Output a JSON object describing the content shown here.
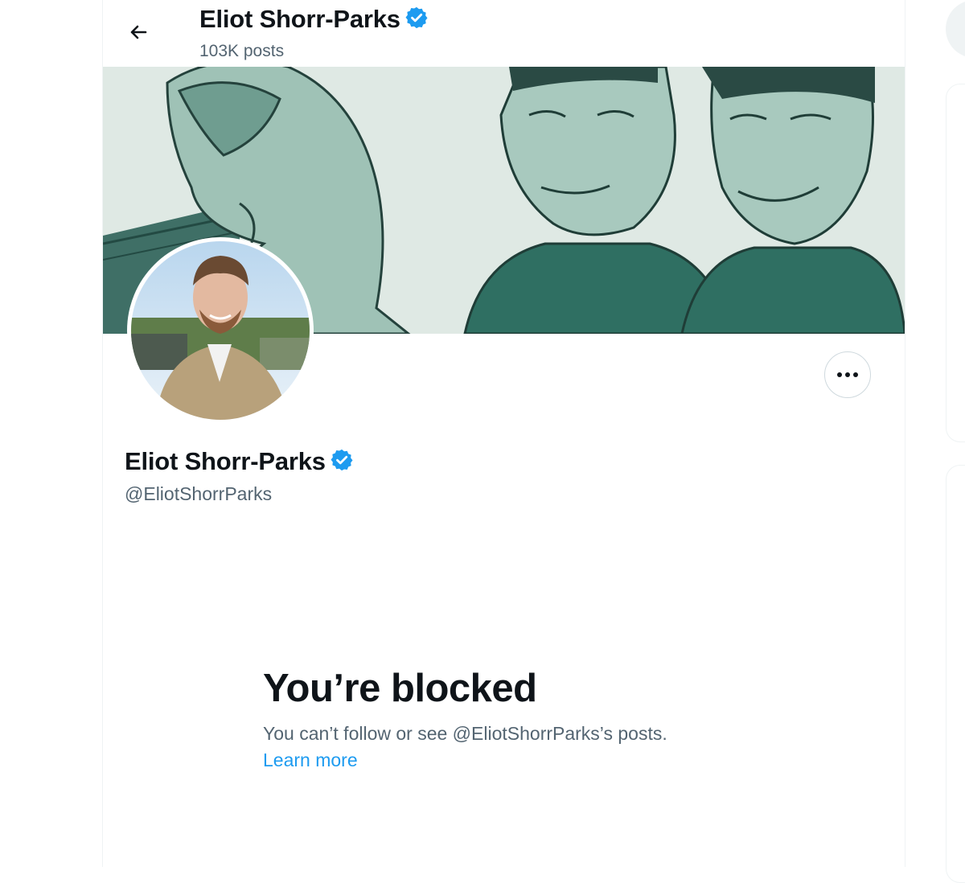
{
  "header": {
    "name": "Eliot Shorr-Parks",
    "posts_count": "103K posts"
  },
  "profile": {
    "name": "Eliot Shorr-Parks",
    "handle": "@EliotShorrParks",
    "verified": true
  },
  "blocked": {
    "title": "You’re blocked",
    "message": "You can’t follow or see @EliotShorrParks’s posts.",
    "learn_more": "Learn more"
  },
  "colors": {
    "accent": "#1d9bf0",
    "secondary_text": "#536471",
    "banner_green": "#2f6f62"
  },
  "icons": [
    "back-arrow-icon",
    "verified-badge-icon",
    "more-options-icon"
  ]
}
